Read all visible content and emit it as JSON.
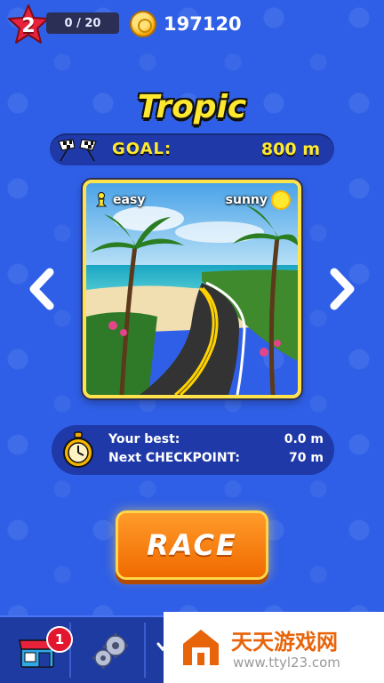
{
  "hud": {
    "level": "2",
    "xp_progress": "0 / 20",
    "coins": "197120"
  },
  "track": {
    "name": "Tropic",
    "goal_label": "GOAL:",
    "goal_value": "800 m",
    "difficulty": "easy",
    "weather": "sunny"
  },
  "stats": {
    "best_label": "Your best:",
    "best_value": "0.0 m",
    "checkpoint_label": "Next CHECKPOINT:",
    "checkpoint_value": "70 m"
  },
  "race_button": "RACE",
  "bottom_bar": {
    "shop_badge": "1"
  },
  "watermark": {
    "title": "天天游戏网",
    "url": "www.ttyl23.com"
  },
  "colors": {
    "background": "#2f5fe6",
    "accent_yellow": "#ffe830",
    "race_orange": "#f06a00",
    "badge_red": "#e2162f"
  },
  "icons": [
    "star-icon",
    "coin-icon",
    "checkered-flags-icon",
    "pawn-icon",
    "sun-icon",
    "chevron-left-icon",
    "chevron-right-icon",
    "stopwatch-icon",
    "shop-icon",
    "gears-icon"
  ]
}
